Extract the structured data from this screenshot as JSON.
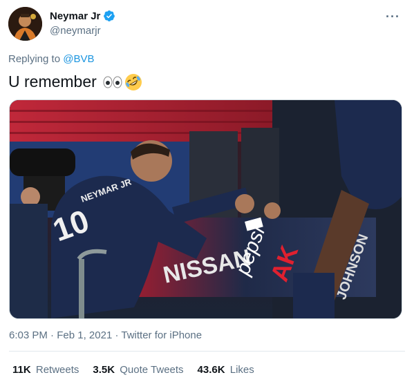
{
  "author": {
    "display_name": "Neymar Jr",
    "handle": "@neymarjr",
    "verified_icon": "verified-badge-icon",
    "avatar": "avatar-image"
  },
  "more_icon": "more-options-icon",
  "more_glyph": "···",
  "reply": {
    "prefix": "Replying to",
    "mention": "@BVB"
  },
  "tweet": {
    "text": "U remember",
    "emojis": [
      "eyes-emoji",
      "rolling-on-floor-laughing-emoji"
    ]
  },
  "media": {
    "type": "photo",
    "jersey_name": "NEYMAR JR",
    "jersey_number": "10",
    "ad_board_texts": [
      "NISSAN",
      "pepsi",
      "AK",
      "JOHNSON"
    ]
  },
  "meta": {
    "time": "6:03 PM",
    "separator1": "·",
    "date": "Feb 1, 2021",
    "separator2": "·",
    "source": "Twitter for iPhone"
  },
  "stats": {
    "retweets_count": "11K",
    "retweets_label": "Retweets",
    "quote_count": "3.5K",
    "quote_label": "Quote Tweets",
    "likes_count": "43.6K",
    "likes_label": "Likes"
  },
  "colors": {
    "link": "#1b95e0",
    "secondary_text": "#5b7083",
    "primary_text": "#0f1419",
    "divider": "#e1e8ed",
    "psg_navy": "#1c2a4e"
  }
}
